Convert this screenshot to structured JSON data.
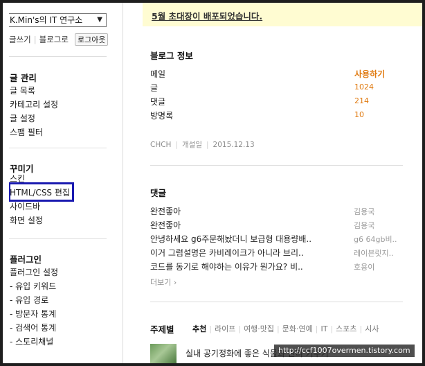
{
  "sidebar": {
    "blog_name": "K.Min's의 IT 연구소",
    "write_link": "글쓰기",
    "blog_link": "블로그로",
    "logout_button": "로그아웃",
    "sections": [
      {
        "title": "글 관리",
        "items": [
          "글 목록",
          "카테고리 설정",
          "글 설정",
          "스팸 필터"
        ]
      },
      {
        "title": "꾸미기",
        "items": [
          "스킨",
          "HTML/CSS 편집",
          "사이드바",
          "화면 설정"
        ]
      },
      {
        "title": "플러그인",
        "items": [
          "플러그인 설정",
          "- 유입 키워드",
          "- 유입 경로",
          "- 방문자 통계",
          "- 검색어 통계",
          "- 스토리채널"
        ]
      }
    ]
  },
  "main": {
    "notice": "5월 초대장이 배포되었습니다.",
    "blog_info": {
      "title": "블로그 정보",
      "rows": [
        {
          "label": "메일",
          "value": "사용하기"
        },
        {
          "label": "글",
          "value": "1024"
        },
        {
          "label": "댓글",
          "value": "214"
        },
        {
          "label": "방명록",
          "value": "10"
        }
      ],
      "meta_name": "CHCH",
      "meta_opened_label": "개설일",
      "meta_opened_date": "2015.12.13"
    },
    "comments": {
      "title": "댓글",
      "items": [
        {
          "text": "완전좋아",
          "author": "김용국"
        },
        {
          "text": "완전좋아",
          "author": "김용국"
        },
        {
          "text": "안녕하세요 g6주문해놨더니 보급형 대용량배..",
          "author": "g6 64gb비.."
        },
        {
          "text": "이거 그럼설명은 카비레이크가 아니라 브리..",
          "author": "레이븐릿지.."
        },
        {
          "text": "코드를 동기로 해야하는 이유가 뭔가요? 비..",
          "author": "호용이"
        }
      ],
      "more_label": "더보기 ›"
    },
    "topics": {
      "label": "주제별",
      "tabs": [
        "추천",
        "라이프",
        "여행·맛집",
        "문화·연예",
        "IT",
        "스포츠",
        "시사"
      ],
      "post_title": "실내 공기정화에 좋은 식물과 관리 키우기"
    }
  },
  "watermark": "http://ccf1007overmen.tistory.com"
}
